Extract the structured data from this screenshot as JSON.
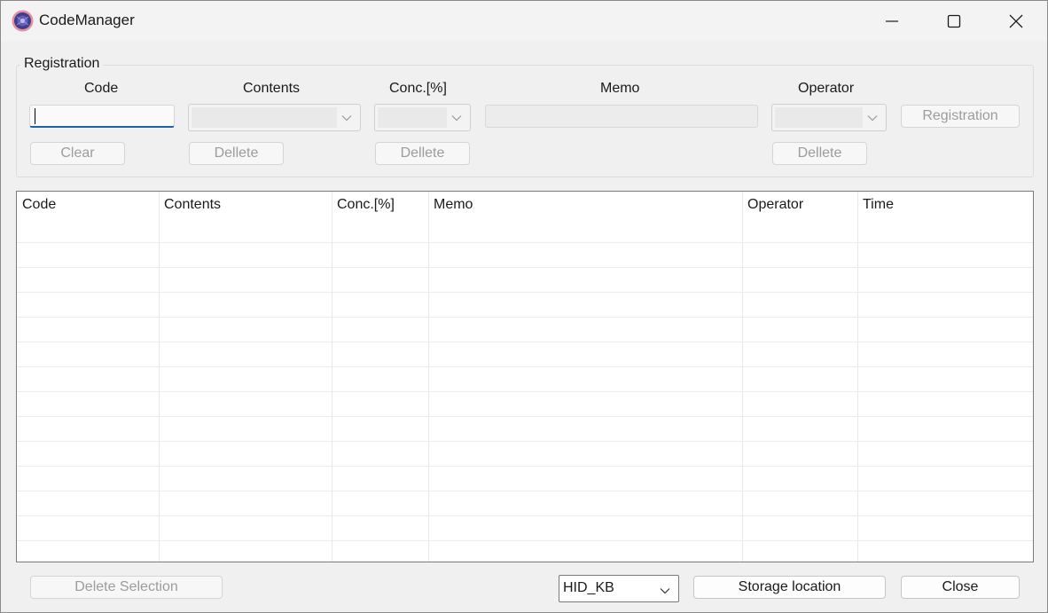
{
  "window": {
    "title": "CodeManager"
  },
  "registration": {
    "group_label": "Registration",
    "labels": {
      "code": "Code",
      "contents": "Contents",
      "conc": "Conc.[%]",
      "memo": "Memo",
      "operator": "Operator"
    },
    "code_value": "",
    "buttons": {
      "clear": "Clear",
      "delete_contents": "Dellete",
      "delete_conc": "Dellete",
      "delete_operator": "Dellete",
      "registration": "Registration"
    }
  },
  "table": {
    "columns": [
      "Code",
      "Contents",
      "Conc.[%]",
      "Memo",
      "Operator",
      "Time"
    ],
    "rows": []
  },
  "bottom": {
    "delete_selection": "Delete Selection",
    "input_mode": "HID_KB",
    "storage_location": "Storage location",
    "close": "Close"
  },
  "icons": {
    "app": "app-icon",
    "minimize": "minimize-icon",
    "maximize": "maximize-icon",
    "close": "close-icon",
    "dropdown": "chevron-down-icon"
  },
  "colors": {
    "focus_underline": "#1f5fa8",
    "window_bg": "#f0f0f0",
    "disabled_text": "#9c9c9c"
  }
}
